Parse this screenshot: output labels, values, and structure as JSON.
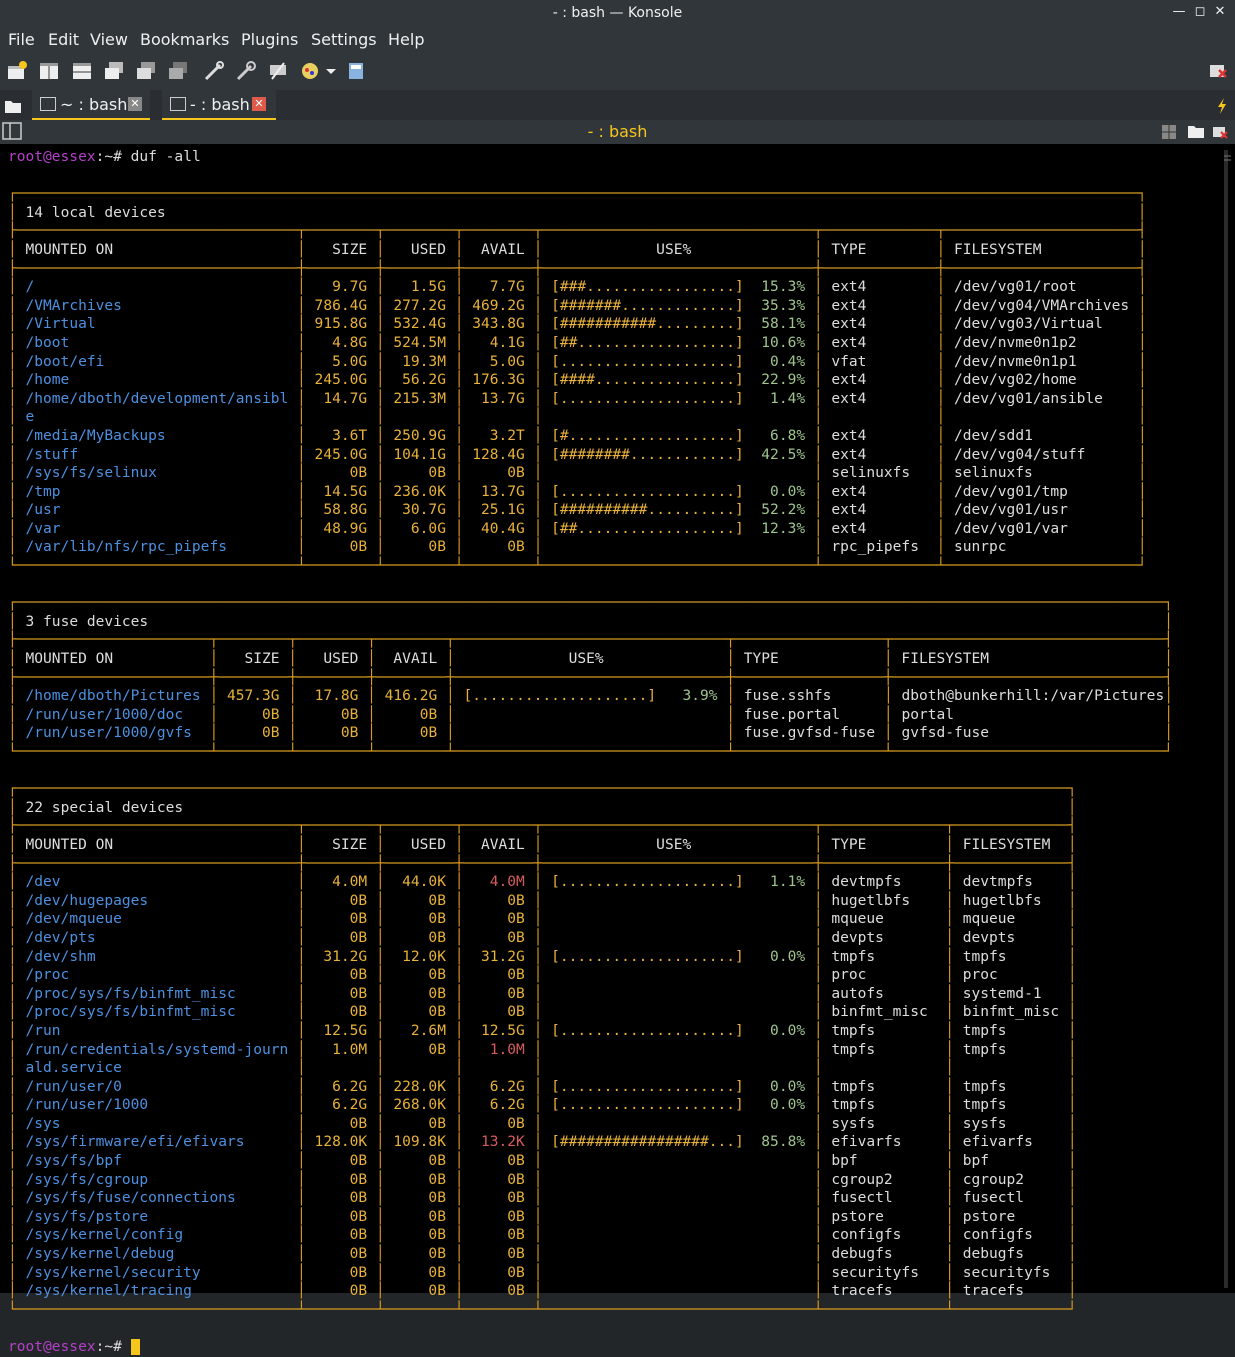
{
  "window": {
    "title": "- : bash — Konsole"
  },
  "menu": [
    "File",
    "Edit",
    "View",
    "Bookmarks",
    "Plugins",
    "Settings",
    "Help"
  ],
  "tabs": [
    {
      "label": "~ : bash"
    },
    {
      "label": "- : bash"
    }
  ],
  "terminal_title": "- : bash",
  "colors": {
    "accent": "#f7c61d",
    "border": "#d89a1f",
    "prompt": "#b340c8",
    "path": "#4d90e0",
    "green": "#9fc48f",
    "red": "#d65c5c"
  },
  "icons": [
    "new-tab-icon",
    "split-view-icon",
    "bookmark-icon",
    "settings-tools-icon",
    "close-session-icon"
  ],
  "prompt": {
    "user_host": "root@essex",
    "sep": ":~# ",
    "command": "duf -all"
  },
  "groups": [
    {
      "title": "14 local devices",
      "headers": [
        "MOUNTED ON",
        "SIZE",
        "USED",
        "AVAIL",
        "USE%",
        "TYPE",
        "FILESYSTEM"
      ],
      "rows": [
        [
          "/",
          "9.7G",
          "1.5G",
          "7.7G",
          "[###.................]",
          "15.3%",
          "ext4",
          "/dev/vg01/root"
        ],
        [
          "/VMArchives",
          "786.4G",
          "277.2G",
          "469.2G",
          "[#######.............]",
          "35.3%",
          "ext4",
          "/dev/vg04/VMArchives"
        ],
        [
          "/Virtual",
          "915.8G",
          "532.4G",
          "343.8G",
          "[###########.........]",
          "58.1%",
          "ext4",
          "/dev/vg03/Virtual"
        ],
        [
          "/boot",
          "4.8G",
          "524.5M",
          "4.1G",
          "[##..................]",
          "10.6%",
          "ext4",
          "/dev/nvme0n1p2"
        ],
        [
          "/boot/efi",
          "5.0G",
          "19.3M",
          "5.0G",
          "[....................]",
          "0.4%",
          "vfat",
          "/dev/nvme0n1p1"
        ],
        [
          "/home",
          "245.0G",
          "56.2G",
          "176.3G",
          "[####................]",
          "22.9%",
          "ext4",
          "/dev/vg02/home"
        ],
        [
          "/home/dboth/development/ansibl",
          "14.7G",
          "215.3M",
          "13.7G",
          "[....................]",
          "1.4%",
          "ext4",
          "/dev/vg01/ansible"
        ],
        [
          "e",
          "",
          "",
          "",
          "",
          "",
          "",
          ""
        ],
        [
          "/media/MyBackups",
          "3.6T",
          "250.9G",
          "3.2T",
          "[#...................]",
          "6.8%",
          "ext4",
          "/dev/sdd1"
        ],
        [
          "/stuff",
          "245.0G",
          "104.1G",
          "128.4G",
          "[########............]",
          "42.5%",
          "ext4",
          "/dev/vg04/stuff"
        ],
        [
          "/sys/fs/selinux",
          "0B",
          "0B",
          "0B",
          "",
          "",
          "selinuxfs",
          "selinuxfs"
        ],
        [
          "/tmp",
          "14.5G",
          "236.0K",
          "13.7G",
          "[....................]",
          "0.0%",
          "ext4",
          "/dev/vg01/tmp"
        ],
        [
          "/usr",
          "58.8G",
          "30.7G",
          "25.1G",
          "[##########..........]",
          "52.2%",
          "ext4",
          "/dev/vg01/usr"
        ],
        [
          "/var",
          "48.9G",
          "6.0G",
          "40.4G",
          "[##..................]",
          "12.3%",
          "ext4",
          "/dev/vg01/var"
        ],
        [
          "/var/lib/nfs/rpc_pipefs",
          "0B",
          "0B",
          "0B",
          "",
          "",
          "rpc_pipefs",
          "sunrpc"
        ]
      ]
    },
    {
      "title": "3 fuse devices",
      "headers": [
        "MOUNTED ON",
        "SIZE",
        "USED",
        "AVAIL",
        "USE%",
        "TYPE",
        "FILESYSTEM"
      ],
      "rows": [
        [
          "/home/dboth/Pictures",
          "457.3G",
          "17.8G",
          "416.2G",
          "[....................]",
          "3.9%",
          "fuse.sshfs",
          "dboth@bunkerhill:/var/Pictures"
        ],
        [
          "/run/user/1000/doc",
          "0B",
          "0B",
          "0B",
          "",
          "",
          "fuse.portal",
          "portal"
        ],
        [
          "/run/user/1000/gvfs",
          "0B",
          "0B",
          "0B",
          "",
          "",
          "fuse.gvfsd-fuse",
          "gvfsd-fuse"
        ]
      ]
    },
    {
      "title": "22 special devices",
      "headers": [
        "MOUNTED ON",
        "SIZE",
        "USED",
        "AVAIL",
        "USE%",
        "TYPE",
        "FILESYSTEM"
      ],
      "rows": [
        [
          "/dev",
          "4.0M",
          "44.0K",
          "4.0M",
          "[....................]",
          "1.1%",
          "devtmpfs",
          "devtmpfs"
        ],
        [
          "/dev/hugepages",
          "0B",
          "0B",
          "0B",
          "",
          "",
          "hugetlbfs",
          "hugetlbfs"
        ],
        [
          "/dev/mqueue",
          "0B",
          "0B",
          "0B",
          "",
          "",
          "mqueue",
          "mqueue"
        ],
        [
          "/dev/pts",
          "0B",
          "0B",
          "0B",
          "",
          "",
          "devpts",
          "devpts"
        ],
        [
          "/dev/shm",
          "31.2G",
          "12.0K",
          "31.2G",
          "[....................]",
          "0.0%",
          "tmpfs",
          "tmpfs"
        ],
        [
          "/proc",
          "0B",
          "0B",
          "0B",
          "",
          "",
          "proc",
          "proc"
        ],
        [
          "/proc/sys/fs/binfmt_misc",
          "0B",
          "0B",
          "0B",
          "",
          "",
          "autofs",
          "systemd-1"
        ],
        [
          "/proc/sys/fs/binfmt_misc",
          "0B",
          "0B",
          "0B",
          "",
          "",
          "binfmt_misc",
          "binfmt_misc"
        ],
        [
          "/run",
          "12.5G",
          "2.6M",
          "12.5G",
          "[....................]",
          "0.0%",
          "tmpfs",
          "tmpfs"
        ],
        [
          "/run/credentials/systemd-journ",
          "1.0M",
          "0B",
          "1.0M",
          "",
          "",
          "tmpfs",
          "tmpfs"
        ],
        [
          "ald.service",
          "",
          "",
          "",
          "",
          "",
          "",
          ""
        ],
        [
          "/run/user/0",
          "6.2G",
          "228.0K",
          "6.2G",
          "[....................]",
          "0.0%",
          "tmpfs",
          "tmpfs"
        ],
        [
          "/run/user/1000",
          "6.2G",
          "268.0K",
          "6.2G",
          "[....................]",
          "0.0%",
          "tmpfs",
          "tmpfs"
        ],
        [
          "/sys",
          "0B",
          "0B",
          "0B",
          "",
          "",
          "sysfs",
          "sysfs"
        ],
        [
          "/sys/firmware/efi/efivars",
          "128.0K",
          "109.8K",
          "13.2K",
          "[#################...]",
          "85.8%",
          "efivarfs",
          "efivarfs"
        ],
        [
          "/sys/fs/bpf",
          "0B",
          "0B",
          "0B",
          "",
          "",
          "bpf",
          "bpf"
        ],
        [
          "/sys/fs/cgroup",
          "0B",
          "0B",
          "0B",
          "",
          "",
          "cgroup2",
          "cgroup2"
        ],
        [
          "/sys/fs/fuse/connections",
          "0B",
          "0B",
          "0B",
          "",
          "",
          "fusectl",
          "fusectl"
        ],
        [
          "/sys/fs/pstore",
          "0B",
          "0B",
          "0B",
          "",
          "",
          "pstore",
          "pstore"
        ],
        [
          "/sys/kernel/config",
          "0B",
          "0B",
          "0B",
          "",
          "",
          "configfs",
          "configfs"
        ],
        [
          "/sys/kernel/debug",
          "0B",
          "0B",
          "0B",
          "",
          "",
          "debugfs",
          "debugfs"
        ],
        [
          "/sys/kernel/security",
          "0B",
          "0B",
          "0B",
          "",
          "",
          "securityfs",
          "securityfs"
        ],
        [
          "/sys/kernel/tracing",
          "0B",
          "0B",
          "0B",
          "",
          "",
          "tracefs",
          "tracefs"
        ]
      ]
    }
  ]
}
